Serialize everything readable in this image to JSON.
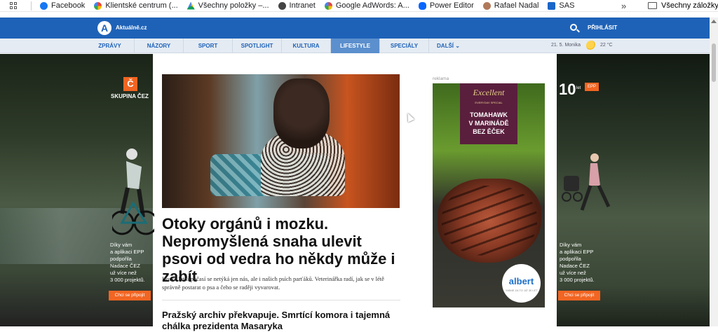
{
  "bookmarks": {
    "items": [
      {
        "label": "Facebook",
        "icon": "facebook-icon",
        "color": "#1877f2"
      },
      {
        "label": "Klientské centrum (...",
        "icon": "google-icon",
        "color": "#555555"
      },
      {
        "label": "Všechny položky –...",
        "icon": "drive-icon",
        "color": "#f4b400"
      },
      {
        "label": "Intranet",
        "icon": "globe-icon",
        "color": "#333333"
      },
      {
        "label": "Google AdWords: A...",
        "icon": "google-icon",
        "color": "#555555"
      },
      {
        "label": "Power Editor",
        "icon": "meta-icon",
        "color": "#0866ff"
      },
      {
        "label": "Rafael Nadal",
        "icon": "avatar-icon",
        "color": "#b07a5a"
      },
      {
        "label": "SAS",
        "icon": "sas-icon",
        "color": "#1a66c9"
      }
    ],
    "more": "»",
    "all_bookmarks": "Všechny záložky"
  },
  "header": {
    "logo_letter": "A",
    "logo_text": "Aktuálně.cz",
    "login": "PŘIHLÁSIT",
    "brand_color": "#1e62b8"
  },
  "nav": {
    "items": [
      "ZPRÁVY",
      "NÁZORY",
      "SPORT",
      "SPOTLIGHT",
      "KULTURA",
      "LIFESTYLE",
      "SPECIÁLY",
      "DALŠÍ"
    ],
    "active": "LIFESTYLE",
    "more_arrow": "⌄",
    "date": "21. 5. Monika",
    "temperature": "22 °C",
    "weather_icon": "sun-cloud-icon"
  },
  "article": {
    "headline": "Otoky orgánů i mozku. Nepromyšlená snaha ulevit psovi od vedra ho někdy může i zabít",
    "perex": "Horké letní počasí se netýká jen nás, ale i našich psích parťáků. Veterinářka radí, jak se v létě správně postarat o psa a čeho se raději vyvarovat.",
    "second_headline": "Pražský archiv překvapuje. Smrtící komora i tajemná chálka prezidenta Masaryka"
  },
  "ad_left": {
    "brand_letter": "Č",
    "brand": "SKUPINA ČEZ",
    "copy": "Díky vám\na aplikaci EPP\npodpořila\nNadace ČEZ\nuž více než\n3 000 projektů.",
    "button": "Chci se připojit"
  },
  "ad_right": {
    "big_number": "10",
    "small_text": "let",
    "badge": "EPP",
    "copy": "Díky vám\na aplikaci EPP\npodpořila\nNadace ČEZ\nuž více než\n3 000 projektů.",
    "button": "Chci se připojit"
  },
  "ad_middle": {
    "label": "reklama",
    "brand_script": "Excellent",
    "tagline": "EVERYDAY SPECIAL",
    "title": "TOMAHAWK\nV MARINÁDĚ\nBEZ ĚČEK",
    "store": "albert",
    "store_sub": "MÁME ZA TO JIŽ 30 LET"
  }
}
